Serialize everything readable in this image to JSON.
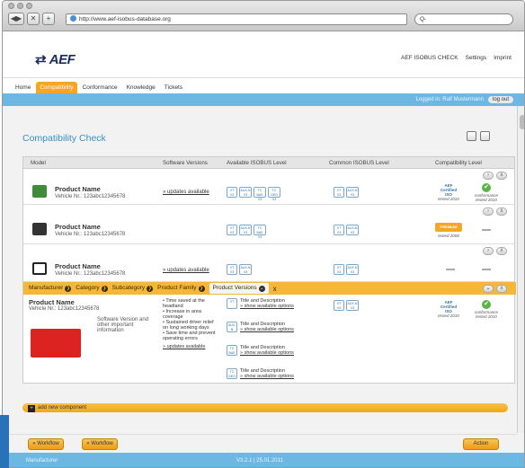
{
  "browser": {
    "url": "http://www.aef-isobus-database.org",
    "search_placeholder": "Q-"
  },
  "header": {
    "logo": "AEF",
    "links": [
      "AEF ISOBUS CHECK",
      "Settings",
      "Imprint"
    ]
  },
  "nav": {
    "tabs": [
      "Home",
      "Compatibility",
      "Conformance",
      "Knowledge",
      "Tickets"
    ],
    "active": "Compatibility"
  },
  "user": {
    "logged_in": "Logged in: Ralf Mustermann",
    "logout": "log out"
  },
  "page": {
    "title": "Compatibility Check"
  },
  "table": {
    "headers": [
      "Model",
      "Software Versions",
      "Available ISOBUS Level",
      "Common ISOBUS Level",
      "Compatibility Level"
    ],
    "rows": [
      {
        "name": "Product Name",
        "vehicle": "Vehicle Nr.: 123abc12345678",
        "updates": "» updates available",
        "cert": "AEF Certified",
        "tested": "tested 2010",
        "conformance": "conformance",
        "conf_tested": "tested 2010"
      },
      {
        "name": "Product Name",
        "vehicle": "Vehicle Nr.: 123abc12345678",
        "premium": "PREMIUM",
        "tested": "tested 2008"
      },
      {
        "name": "Product Name",
        "vehicle": "Vehicle Nr.: 123abc12345678",
        "updates": "» updates available"
      }
    ]
  },
  "breadcrumb": {
    "items": [
      "Manufacturer",
      "Category",
      "Subcategory",
      "Product Family",
      "Product Versions"
    ],
    "close": "x"
  },
  "detail": {
    "name": "Product Name",
    "vehicle": "Vehicle Nr.: 123abc12345678",
    "software_info": "Software Version and other important information",
    "benefits": [
      "• Time saved at the headland",
      "• Increase in area coverage",
      "• Sustained driver relief on long working days",
      "• Save time and prevent operating errors"
    ],
    "updates": "» updates available",
    "options": [
      {
        "title": "Title and Description",
        "link": "» show available options"
      },
      {
        "title": "Title and Description",
        "link": "» show available options"
      },
      {
        "title": "Title and Description",
        "link": "» show available options"
      },
      {
        "title": "Title and Description",
        "link": "» show available options"
      }
    ],
    "cert": "AEF Certified",
    "tested": "tested 2010",
    "conformance": "conformance",
    "conf_tested": "tested 2010"
  },
  "add_component": "add new component",
  "actions": {
    "workflow1": "» Workflow",
    "workflow2": "» Workflow",
    "action": "Action"
  },
  "footer": {
    "left": "Manufacturer",
    "version": "V3.2.1 | 25.01.2011"
  },
  "badge_labels": {
    "vt": "VT",
    "aux": "AUX-N",
    "tc": "TC BAS",
    "tcg": "TC GEO",
    "v": "V3"
  },
  "colors": {
    "accent_orange": "#f5a623",
    "blue_bar": "#6cb8e3",
    "title_blue": "#3a8fc5",
    "check_green": "#5bb44a"
  }
}
